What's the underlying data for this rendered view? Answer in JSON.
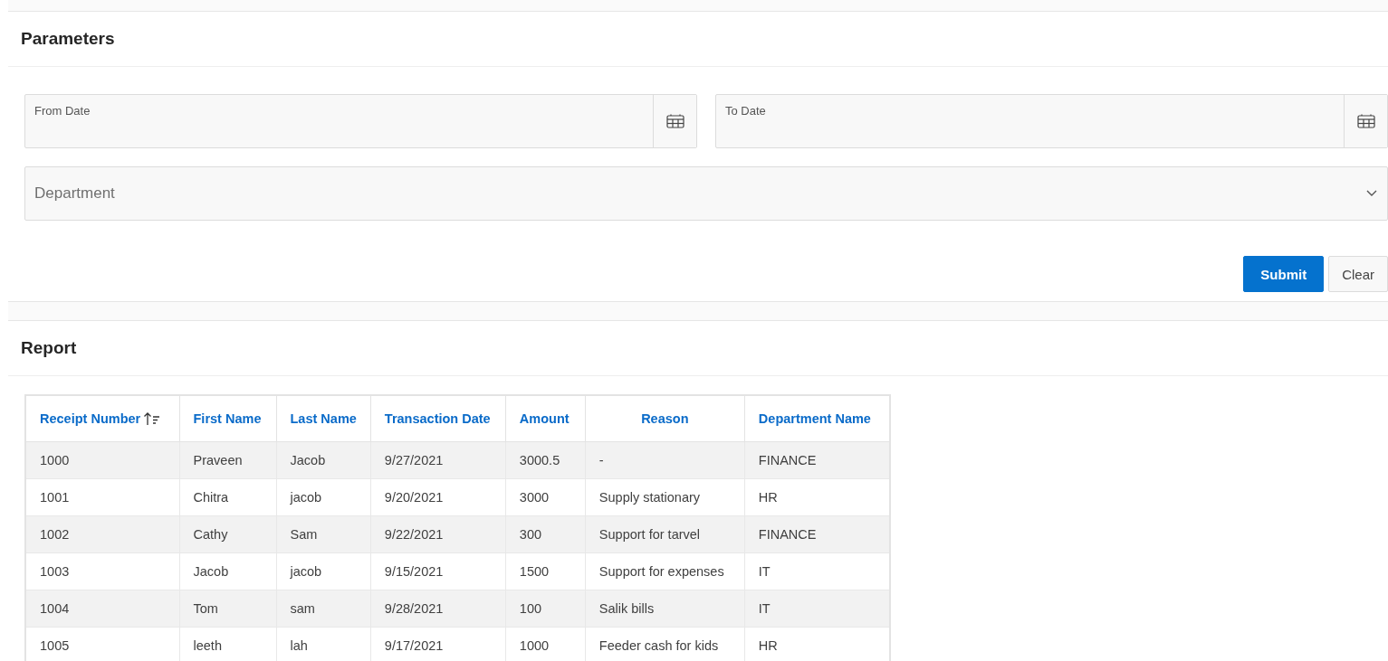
{
  "parameters": {
    "title": "Parameters",
    "date_fields": [
      {
        "label": "From Date"
      },
      {
        "label": "To Date"
      }
    ],
    "department": {
      "placeholder": "Department"
    },
    "buttons": [
      {
        "label": "Submit",
        "kind": "primary"
      },
      {
        "label": "Clear",
        "kind": "secondary"
      }
    ]
  },
  "report": {
    "title": "Report",
    "columns": [
      {
        "label": "Receipt Number",
        "sorted": true
      },
      {
        "label": "First Name",
        "sorted": false
      },
      {
        "label": "Last Name",
        "sorted": false
      },
      {
        "label": "Transaction Date",
        "sorted": false
      },
      {
        "label": "Amount",
        "sorted": false
      },
      {
        "label": "Reason",
        "sorted": false
      },
      {
        "label": "Department Name",
        "sorted": false
      }
    ],
    "rows": [
      [
        "1000",
        "Praveen",
        "Jacob",
        "9/27/2021",
        "3000.5",
        "-",
        "FINANCE"
      ],
      [
        "1001",
        "Chitra",
        "jacob",
        "9/20/2021",
        "3000",
        "Supply stationary",
        "HR"
      ],
      [
        "1002",
        "Cathy",
        "Sam",
        "9/22/2021",
        "300",
        "Support for tarvel",
        "FINANCE"
      ],
      [
        "1003",
        "Jacob",
        "jacob",
        "9/15/2021",
        "1500",
        "Support for expenses",
        "IT"
      ],
      [
        "1004",
        "Tom",
        "sam",
        "9/28/2021",
        "100",
        "Salik bills",
        "IT"
      ],
      [
        "1005",
        "leeth",
        "lah",
        "9/17/2021",
        "1000",
        "Feeder cash for kids",
        "HR"
      ]
    ]
  }
}
